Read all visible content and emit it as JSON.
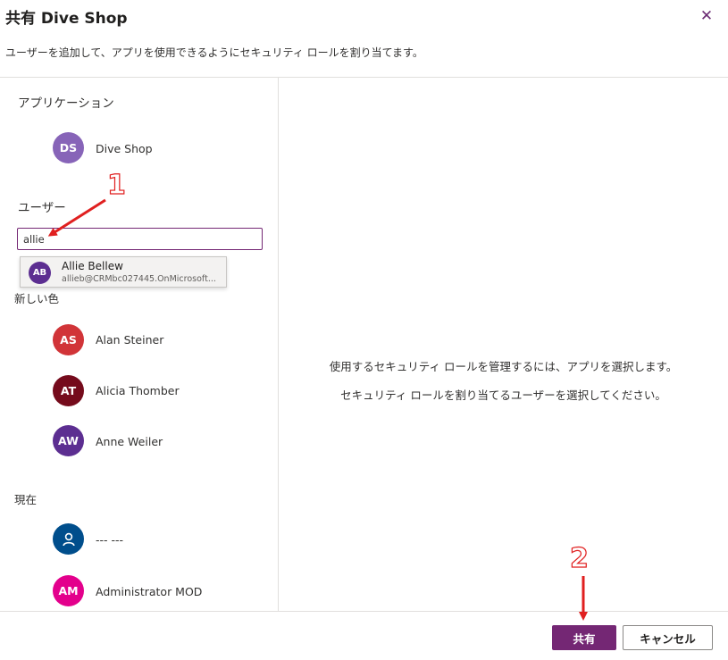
{
  "dialog": {
    "title": "共有 Dive Shop",
    "subtitle": "ユーザーを追加して、アプリを使用できるようにセキュリティ ロールを割り当てます。",
    "close_icon": "close-icon"
  },
  "application": {
    "heading": "アプリケーション",
    "app": {
      "initials": "DS",
      "name": "Dive Shop",
      "color": "#8764b8"
    }
  },
  "users": {
    "heading": "ユーザー",
    "search_value": "allie",
    "suggestion": {
      "initials": "AB",
      "name": "Allie Bellew",
      "email": "allieb@CRMbc027445.OnMicrosoft...",
      "color": "#5c2e91"
    }
  },
  "new_section": {
    "heading": "新しい色",
    "people": [
      {
        "initials": "AS",
        "name": "Alan Steiner",
        "color": "#d13438"
      },
      {
        "initials": "AT",
        "name": "Alicia Thomber",
        "color": "#750b1c"
      },
      {
        "initials": "AW",
        "name": "Anne Weiler",
        "color": "#5c2e91"
      }
    ]
  },
  "current_section": {
    "heading": "現在",
    "people": [
      {
        "initials": "",
        "name": "--- ---",
        "color": "#004e8c",
        "icon": "person-icon"
      },
      {
        "initials": "AM",
        "name": "Administrator MOD",
        "color": "#e3008c"
      }
    ]
  },
  "right_panel": {
    "line1": "使用するセキュリティ ロールを管理するには、アプリを選択します。",
    "line2": "セキュリティ ロールを割り当てるユーザーを選択してください。"
  },
  "footer": {
    "share_label": "共有",
    "cancel_label": "キャンセル",
    "accent": "#742774"
  },
  "annotations": {
    "one": "1",
    "two": "2",
    "color": "#e02020"
  }
}
